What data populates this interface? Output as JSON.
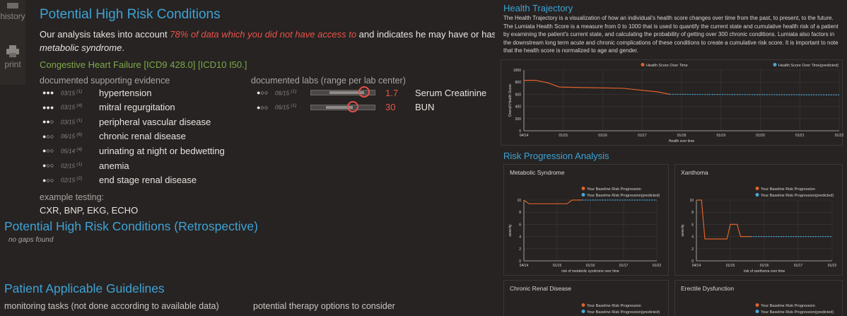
{
  "toolbar": {
    "history_label": "history",
    "print_label": "print"
  },
  "conditions": {
    "title": "Potential High Risk Conditions",
    "intro_part1": "Our analysis takes into account ",
    "intro_highlight": "78% of data which you did not have access to",
    "intro_part2": " and indicates he may have or has a high ri",
    "intro_line2": "metabolic syndrome",
    "intro_line2_end": ".",
    "condition_name": "Congestive Heart Failure [ICD9 428.0] [ICD10 I50.]",
    "evidence_header": "documented supporting evidence",
    "evidence": [
      {
        "dots": "●●●",
        "date": "03/15",
        "sup": "(1)",
        "label": "hypertension"
      },
      {
        "dots": "●●●",
        "date": "03/15",
        "sup": "(4)",
        "label": "mitral regurgitation"
      },
      {
        "dots": "●●○",
        "date": "03/15",
        "sup": "(1)",
        "label": "peripheral vascular disease"
      },
      {
        "dots": "●○○",
        "date": "06/15",
        "sup": "(6)",
        "label": "chronic renal disease"
      },
      {
        "dots": "●○○",
        "date": "05/14",
        "sup": "(4)",
        "label": "urinating at night or bedwetting"
      },
      {
        "dots": "●○○",
        "date": "02/15",
        "sup": "(1)",
        "label": "anemia"
      },
      {
        "dots": "●○○",
        "date": "02/15",
        "sup": "(2)",
        "label": "end stage renal disease"
      }
    ],
    "labs_header": "documented labs (range per lab center)",
    "labs": [
      {
        "dots": "●○○",
        "date": "06/15",
        "sup": "(1)",
        "value": "1.7",
        "name": "Serum Creatinine",
        "fill_fraction": 0.82
      },
      {
        "dots": "●○○",
        "date": "06/15",
        "sup": "(1)",
        "value": "30",
        "name": "BUN",
        "fill_fraction": 0.64
      }
    ],
    "testing_header": "example testing:",
    "testing_value": "CXR, BNP, EKG, ECHO"
  },
  "retro": {
    "title": "Potential High Risk Conditions (Retrospective)",
    "note": "no gaps found"
  },
  "guidelines": {
    "title": "Patient Applicable Guidelines",
    "monitoring_header": "monitoring tasks (not done according to available data)",
    "therapy_header": "potential therapy options to consider"
  },
  "trajectory": {
    "title": "Health Trajectory",
    "description": "The Health Trajectory is a visualization of how an individual's health score changes over time from the past, to present, to the future. The Lumiata Health Score is a measure from 0 to 1000 that is used to quantify the current state and cumulative health risk of a patient by examining the patient's current state, and calculating the probability of getting over 300 chronic conditions. Lumiata also factors in the downstream long term acute and chronic complications of these conditions to create a cumulative risk score. It is important to note that the health score is normalized to age and gender."
  },
  "risk": {
    "title": "Risk Progression Analysis"
  },
  "colors": {
    "accent": "#3fa3d6",
    "past": "#e0622a",
    "predicted": "#4aa8d8",
    "alert": "#e8524a",
    "condition": "#7fa84a"
  },
  "chart_data": [
    {
      "type": "line",
      "title": "",
      "xlabel": "Health over time",
      "ylabel": "Overall Health Score",
      "ylim": [
        0,
        1000
      ],
      "yticks": [
        "0",
        "200",
        "400",
        "600",
        "800",
        "1000"
      ],
      "xticks": [
        "04/14",
        "01/15",
        "01/16",
        "01/17",
        "01/18",
        "01/19",
        "01/20",
        "01/21",
        "01/22"
      ],
      "legend_position": "top-right",
      "series": [
        {
          "name": "Health Score Over Time",
          "x": [
            0,
            0.3,
            0.6,
            0.9,
            1.5,
            2.5,
            3.4,
            3.7
          ],
          "y": [
            830,
            830,
            790,
            720,
            710,
            700,
            640,
            600
          ]
        },
        {
          "name": "Health Score Over Time(predicted)",
          "x": [
            3.7,
            8
          ],
          "y": [
            600,
            590
          ]
        }
      ]
    },
    {
      "type": "line",
      "title": "Metabolic Syndrome",
      "xlabel": "risk of metabolic syndrome over time",
      "ylabel": "severity",
      "ylim": [
        0,
        10
      ],
      "yticks": [
        "0",
        "2",
        "4",
        "6",
        "8",
        "10"
      ],
      "xticks": [
        "04/14",
        "01/15",
        "01/16",
        "01/17",
        "01/22"
      ],
      "legend_position": "top-right",
      "series": [
        {
          "name": "Your Baseline Risk Progression",
          "x": [
            0,
            0.15,
            0.3,
            1.3,
            1.45,
            1.75
          ],
          "y": [
            10,
            9.4,
            9.4,
            9.4,
            10,
            10
          ]
        },
        {
          "name": "Your Baseline Risk Progression(predicted)",
          "x": [
            1.75,
            4
          ],
          "y": [
            10,
            10
          ]
        }
      ]
    },
    {
      "type": "line",
      "title": "Xanthoma",
      "xlabel": "risk of xanthoma over time",
      "ylabel": "severity",
      "ylim": [
        0,
        10
      ],
      "yticks": [
        "0",
        "2",
        "4",
        "6",
        "8",
        "10"
      ],
      "xticks": [
        "04/14",
        "01/15",
        "01/16",
        "01/17",
        "01/22"
      ],
      "legend_position": "top-right",
      "series": [
        {
          "name": "Your Baseline Risk Progression",
          "x": [
            0,
            0.15,
            0.25,
            0.9,
            1.0,
            1.2,
            1.3,
            1.6
          ],
          "y": [
            10,
            10,
            3.6,
            3.6,
            6,
            6,
            4,
            4
          ]
        },
        {
          "name": "Your Baseline Risk Progression(predicted)",
          "x": [
            1.6,
            4
          ],
          "y": [
            4,
            4
          ]
        }
      ]
    }
  ],
  "bottom_cards": [
    {
      "title": "Chronic Renal Disease",
      "legend": [
        "Your Baseline Risk Progression",
        "Your Baseline Risk Progression(predicted)"
      ]
    },
    {
      "title": "Erectile Dysfunction",
      "legend": [
        "Your Baseline Risk Progression",
        "Your Baseline Risk Progression(predicted)"
      ]
    }
  ]
}
